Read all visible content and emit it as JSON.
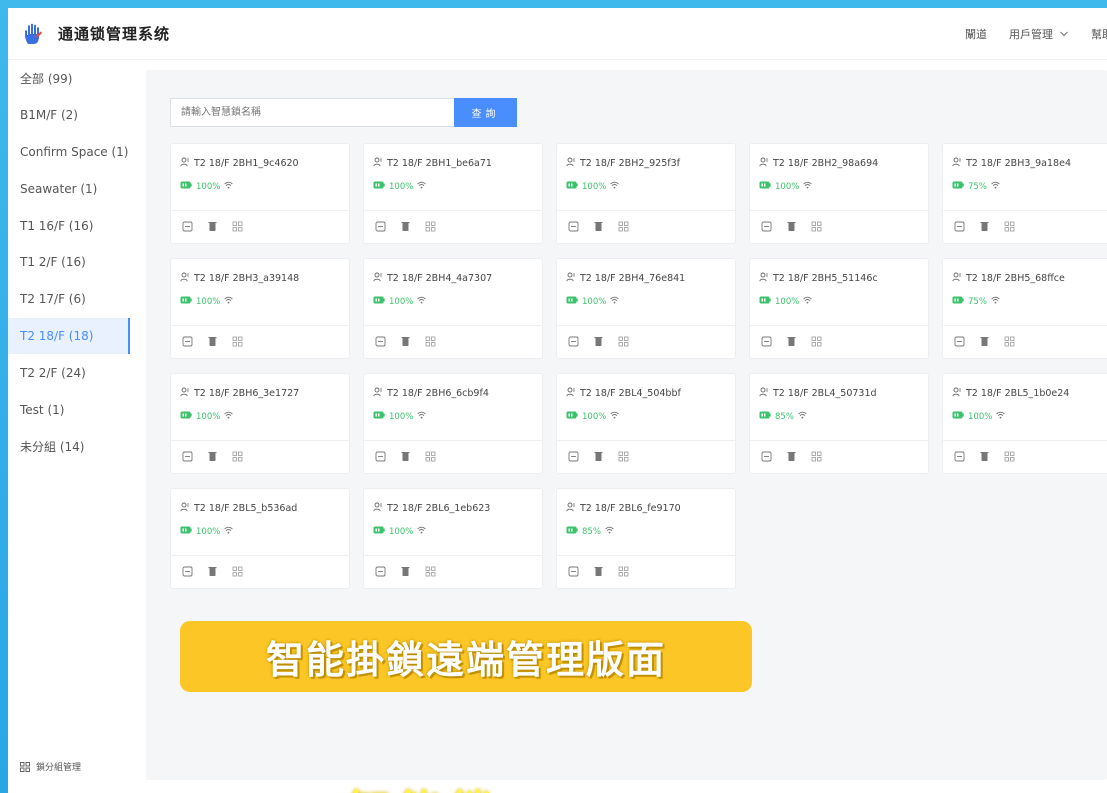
{
  "app": {
    "title": "通通锁管理系统"
  },
  "header": {
    "nav": [
      {
        "label": "闡道"
      },
      {
        "label": "用戶管理"
      },
      {
        "label": "幫助"
      }
    ]
  },
  "sidebar": {
    "items": [
      {
        "label": "全部 (99)"
      },
      {
        "label": "B1M/F (2)"
      },
      {
        "label": "Confirm Space (1)"
      },
      {
        "label": "Seawater (1)"
      },
      {
        "label": "T1 16/F (16)"
      },
      {
        "label": "T1 2/F (16)"
      },
      {
        "label": "T2 17/F (6)"
      },
      {
        "label": "T2 18/F (18)",
        "active": true
      },
      {
        "label": "T2 2/F (24)"
      },
      {
        "label": "Test (1)"
      },
      {
        "label": "未分組 (14)"
      }
    ],
    "footer_label": "鎖分組管理"
  },
  "search": {
    "placeholder": "請輸入智慧鎖名稱",
    "button_label": "查詢"
  },
  "locks": [
    {
      "name": "T2 18/F 2BH1_9c4620",
      "battery": "100%"
    },
    {
      "name": "T2 18/F 2BH1_be6a71",
      "battery": "100%"
    },
    {
      "name": "T2 18/F 2BH2_925f3f",
      "battery": "100%"
    },
    {
      "name": "T2 18/F 2BH2_98a694",
      "battery": "100%"
    },
    {
      "name": "T2 18/F 2BH3_9a18e4",
      "battery": "75%"
    },
    {
      "name": "T2 18/F 2BH3_a39148",
      "battery": "100%"
    },
    {
      "name": "T2 18/F 2BH4_4a7307",
      "battery": "100%"
    },
    {
      "name": "T2 18/F 2BH4_76e841",
      "battery": "100%"
    },
    {
      "name": "T2 18/F 2BH5_51146c",
      "battery": "100%"
    },
    {
      "name": "T2 18/F 2BH5_68ffce",
      "battery": "75%"
    },
    {
      "name": "T2 18/F 2BH6_3e1727",
      "battery": "100%"
    },
    {
      "name": "T2 18/F 2BH6_6cb9f4",
      "battery": "100%"
    },
    {
      "name": "T2 18/F 2BL4_504bbf",
      "battery": "100%"
    },
    {
      "name": "T2 18/F 2BL4_50731d",
      "battery": "85%"
    },
    {
      "name": "T2 18/F 2BL5_1b0e24",
      "battery": "100%"
    },
    {
      "name": "T2 18/F 2BL5_b536ad",
      "battery": "100%"
    },
    {
      "name": "T2 18/F 2BL6_1eb623",
      "battery": "100%"
    },
    {
      "name": "T2 18/F 2BL6_fe9170",
      "battery": "85%"
    }
  ],
  "overlay": {
    "banner_text": "智能掛鎖遠端管理版面",
    "sub_banner_text": "智能鎖"
  },
  "colors": {
    "accent": "#4a8dfc",
    "battery": "#3cc26b",
    "banner": "#fcc726",
    "background_gradient": "#3fb8ec"
  }
}
